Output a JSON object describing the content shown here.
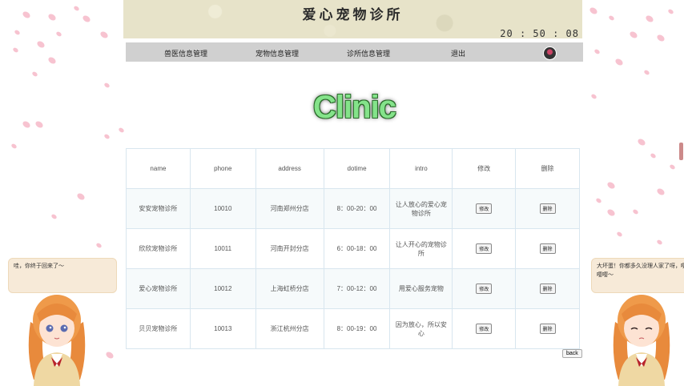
{
  "header": {
    "site_title": "爱心宠物诊所",
    "clock": "20 : 50 : 08"
  },
  "nav": {
    "items": [
      {
        "label": "兽医信息管理"
      },
      {
        "label": "宠物信息管理"
      },
      {
        "label": "诊所信息管理"
      },
      {
        "label": "退出"
      }
    ]
  },
  "main": {
    "heading": "Clinic"
  },
  "table": {
    "columns": [
      "name",
      "phone",
      "address",
      "dotime",
      "intro",
      "修改",
      "删除"
    ],
    "rows": [
      {
        "name": "安安宠物诊所",
        "phone": "10010",
        "address": "河南郑州分店",
        "dotime": "8：00-20：00",
        "intro": "让人放心的爱心宠物诊所"
      },
      {
        "name": "欣欣宠物诊所",
        "phone": "10011",
        "address": "河南开封分店",
        "dotime": "6：00-18：00",
        "intro": "让人开心的宠物诊所"
      },
      {
        "name": "爱心宠物诊所",
        "phone": "10012",
        "address": "上海虹桥分店",
        "dotime": "7：00-12：00",
        "intro": "用爱心服务宠物"
      },
      {
        "name": "贝贝宠物诊所",
        "phone": "10013",
        "address": "浙江杭州分店",
        "dotime": "8：00-19：00",
        "intro": "因为放心，所以安心"
      }
    ],
    "edit_label": "修改",
    "delete_label": "删除"
  },
  "back_label": "back",
  "mascots": {
    "left_bubble": "哇，你终于回来了～",
    "right_bubble": "大坏蛋！你都多久没理人家了呀，嘤嘤嘤～"
  }
}
